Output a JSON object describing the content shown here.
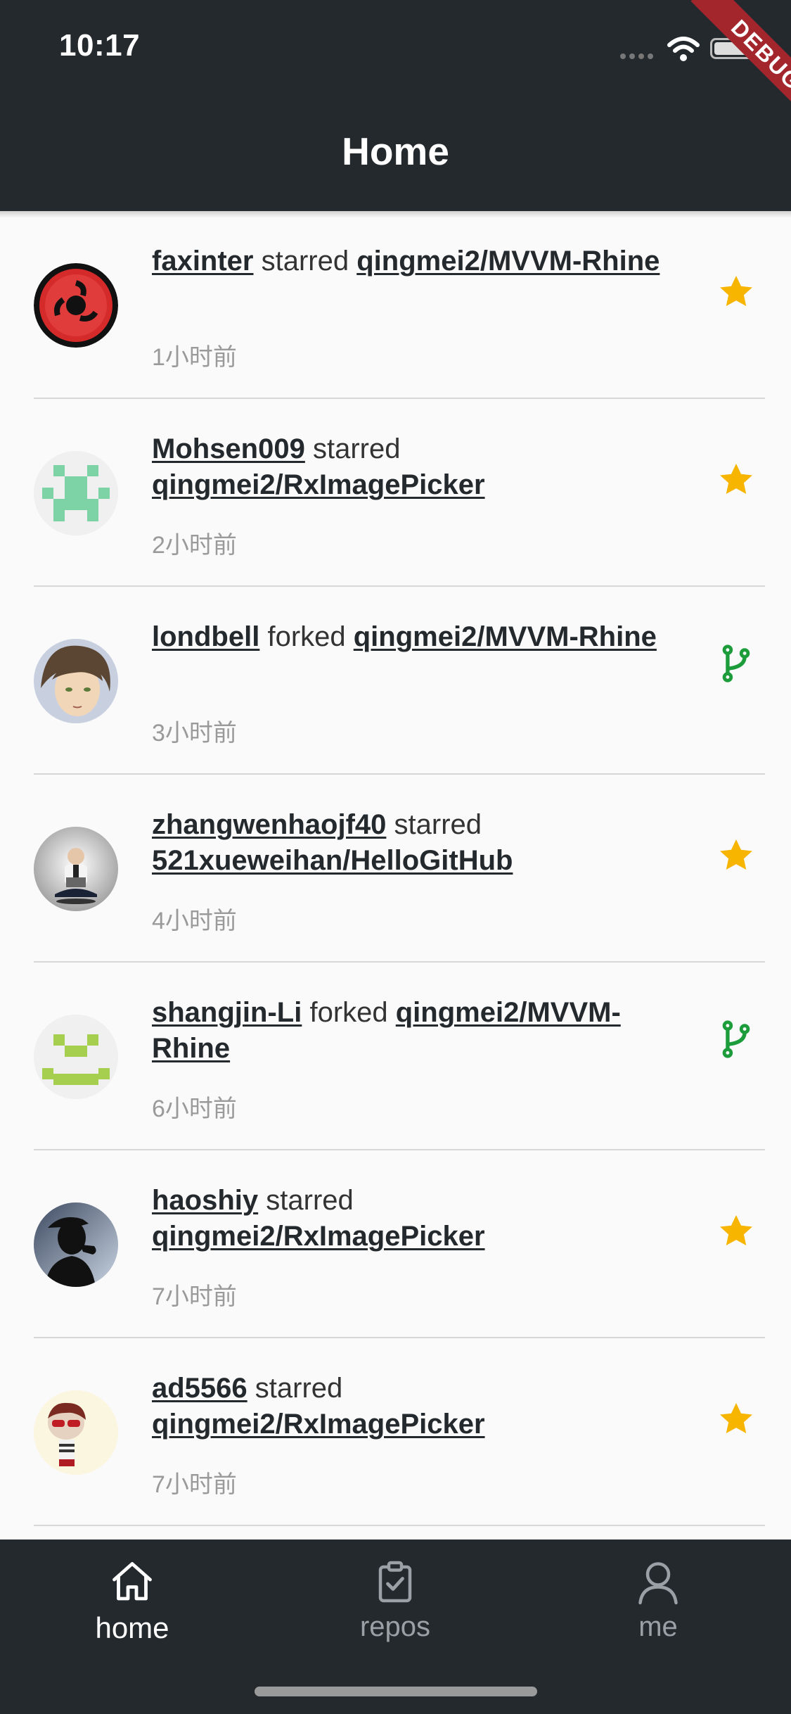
{
  "status_bar": {
    "time": "10:17"
  },
  "debug_ribbon": "DEBUG",
  "header": {
    "title": "Home"
  },
  "feed": [
    {
      "actor": "faxinter",
      "action": "starred",
      "repo": "qingmei2/MVVM-Rhine",
      "time": "1小时前",
      "icon": "star-icon"
    },
    {
      "actor": "Mohsen009",
      "action": "starred",
      "repo": "qingmei2/RxImagePicker",
      "time": "2小时前",
      "icon": "star-icon"
    },
    {
      "actor": "londbell",
      "action": "forked",
      "repo": "qingmei2/MVVM-Rhine",
      "time": "3小时前",
      "icon": "fork-icon"
    },
    {
      "actor": "zhangwenhaojf40",
      "action": "starred",
      "repo": "521xueweihan/HelloGitHub",
      "time": "4小时前",
      "icon": "star-icon"
    },
    {
      "actor": "shangjin-Li",
      "action": "forked",
      "repo": "qingmei2/MVVM-Rhine",
      "time": "6小时前",
      "icon": "fork-icon"
    },
    {
      "actor": "haoshiy",
      "action": "starred",
      "repo": "qingmei2/RxImagePicker",
      "time": "7小时前",
      "icon": "star-icon"
    },
    {
      "actor": "ad5566",
      "action": "starred",
      "repo": "qingmei2/RxImagePicker",
      "time": "7小时前",
      "icon": "star-icon"
    }
  ],
  "bottom_nav": {
    "home_label": "home",
    "repos_label": "repos",
    "me_label": "me",
    "active": "home"
  },
  "colors": {
    "appbar": "#24292e",
    "star": "#f7b500",
    "fork": "#1c9c3a",
    "debug": "#a3262c"
  }
}
